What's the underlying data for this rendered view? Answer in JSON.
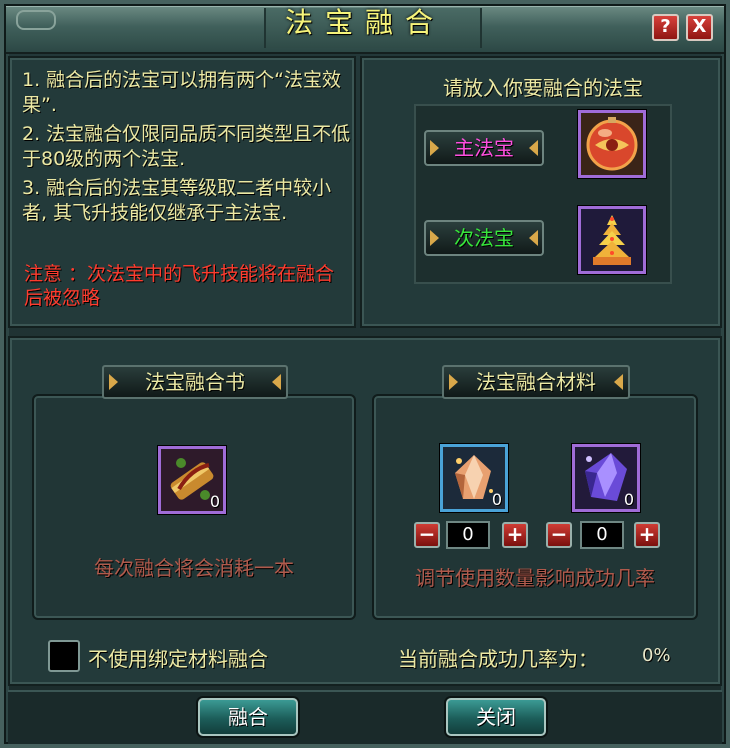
{
  "window": {
    "title": "法宝融合",
    "help_label": "?",
    "close_label": "X"
  },
  "description": {
    "lines": [
      "1. 融合后的法宝可以拥有两个“法宝效果”.",
      "2. 法宝融合仅限同品质不同类型且不低于80级的两个法宝.",
      "3. 融合后的法宝其等级取二者中较小者, 其飞升技能仅继承于主法宝."
    ],
    "warning": "注意 ：次法宝中的飞升技能将在融合后被忽略"
  },
  "slots": {
    "title": "请放入你要融合的法宝",
    "main_label": "主法宝",
    "secondary_label": "次法宝",
    "main_item_icon": "orb-treasure-icon",
    "secondary_item_icon": "pagoda-treasure-icon"
  },
  "book_section": {
    "header": "法宝融合书",
    "item_icon": "fusion-book-icon",
    "item_count": "0",
    "note": "每次融合将会消耗一本"
  },
  "material_section": {
    "header": "法宝融合材料",
    "materials": [
      {
        "icon": "orange-crystal-icon",
        "count": "0",
        "quantity": "0",
        "minus": "−",
        "plus": "+"
      },
      {
        "icon": "purple-crystal-icon",
        "count": "0",
        "quantity": "0",
        "minus": "−",
        "plus": "+"
      }
    ],
    "note": "调节使用数量影响成功几率"
  },
  "options": {
    "no_bound_label": "不使用绑定材料融合",
    "no_bound_checked": false
  },
  "rate": {
    "label": "当前融合成功几率为：",
    "value": "0%"
  },
  "buttons": {
    "fuse": "融合",
    "close": "关闭"
  },
  "colors": {
    "title": "#f6f47a",
    "text": "#ece9a4",
    "warning": "#ff3c2e",
    "main_label": "#ff4fe0",
    "secondary_label": "#37e63b",
    "item_border_purple": "#a06cd8",
    "item_border_blue": "#4aa3d8"
  }
}
